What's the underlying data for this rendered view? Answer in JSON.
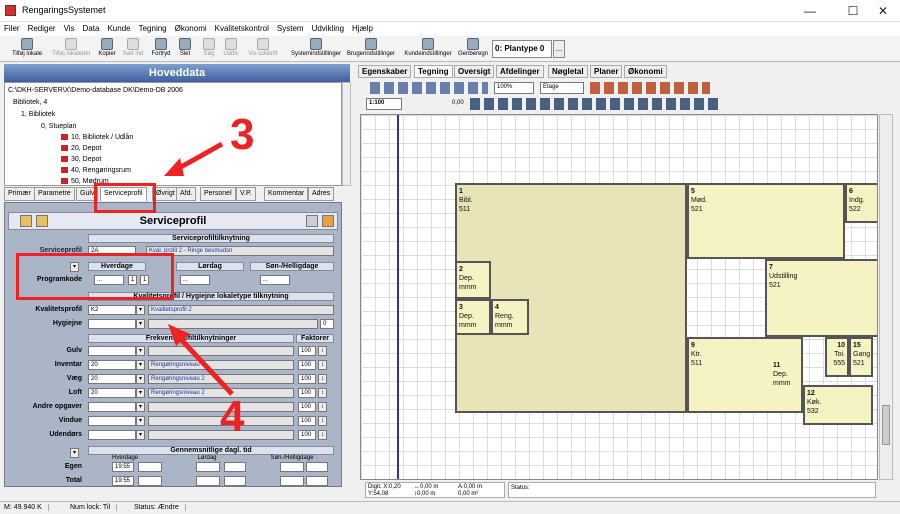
{
  "window": {
    "title": "RengaringsSystemet",
    "min": "—",
    "max": "☐",
    "close": "✕"
  },
  "menu": [
    "Filer",
    "Rediger",
    "Vis",
    "Data",
    "Kunde",
    "Tegning",
    "Økonomi",
    "Kvalitetskontrol",
    "System",
    "Udvikling",
    "Hjælp"
  ],
  "toolbar": [
    "Tilføj lokale",
    "Tilføj lokaledel",
    "Kopier",
    "Sæt ind",
    "Fortryd",
    "Slet",
    "Søg",
    "Uddiv",
    "Vis udskrift",
    "Systemindstillinger",
    "Brugerindstillinger",
    "Kundeindstillinger",
    "Genberegn"
  ],
  "plantype": "0: Plantype 0",
  "plantype_btn": "...",
  "left": {
    "header": "Hoveddata",
    "tree": [
      "C:\\DKH-SERVER\\X\\Demo-database DK\\Demo-DB 2006",
      "Bibliotek, 4",
      "1, Bibliotek",
      "0, Stueplan",
      "10, Bibliotek / Udlån",
      "20, Depot",
      "30, Depot",
      "40, Rengøringsrum",
      "50, Mødrum"
    ],
    "tabs": [
      "Primær",
      "Parametre",
      "Gulv",
      "Serviceprofil",
      "Øvrigt",
      "Afd.",
      "Personel",
      "V.P.",
      "Kommentar",
      "Adres"
    ]
  },
  "sp": {
    "title": "Serviceprofil",
    "sec_tilknytning": "Serviceprofiltilknytning",
    "lbl_serviceprofil": "Serviceprofil",
    "serviceprofil_val": "2A",
    "serviceprofil_desc": "Kval. profil 2 - Ringe besmudsn",
    "col_hverdage": "Hverdage",
    "col_lordag": "Lørdag",
    "col_son": "Søn-/Helligdage",
    "lbl_programkode": "Programkode",
    "prog_h": "...",
    "prog_h2": "1",
    "prog_h3": "1",
    "prog_l": "...",
    "prog_s": "...",
    "sec_kval": "Kvalitetsprofil / Hygiejne lokaletype tilknytning",
    "lbl_kval": "Kvalitetsprofil",
    "kval_val": "K2",
    "kval_desc": "Kvalitetsprofil 2",
    "lbl_hyg": "Hygiejne",
    "hyg_num": "0",
    "sec_frek": "Frekvensprofiltilknytninger",
    "sec_fak": "Faktorer",
    "rows": [
      {
        "label": "Gulv",
        "val": "",
        "desc": "",
        "fak": "100"
      },
      {
        "label": "Inventar",
        "val": "20",
        "desc": "Rengøringsniveau 2",
        "fak": "100"
      },
      {
        "label": "Væg",
        "val": "20",
        "desc": "Rengøringsniveau 2",
        "fak": "100"
      },
      {
        "label": "Loft",
        "val": "20",
        "desc": "Rengøringsniveau 2",
        "fak": "100"
      },
      {
        "label": "Andre opgaver",
        "val": "",
        "desc": "",
        "fak": "100"
      },
      {
        "label": "Vindue",
        "val": "",
        "desc": "",
        "fak": "100"
      },
      {
        "label": "Udendørs",
        "val": "",
        "desc": "",
        "fak": "100"
      }
    ],
    "sec_gen": "Gennemsnitlige dagl. tid",
    "g_h": "Hverdage",
    "g_l": "Lørdag",
    "g_s": "Søn-/Helligdage",
    "lbl_egen": "Egen",
    "egen_h": "19:55",
    "lbl_total": "Total",
    "total_h": "19:55"
  },
  "right": {
    "tabs": [
      "Egenskaber",
      "Tegning",
      "Oversigt",
      "Afdelinger",
      "Nøgletal",
      "Planer",
      "Økonomi"
    ],
    "zoom": "100%",
    "layer": "Etage",
    "scale": "1:100",
    "num": "0,00"
  },
  "rooms": [
    {
      "no": "1",
      "name": "Bibl.",
      "code": "511"
    },
    {
      "no": "5",
      "name": "Mød.",
      "code": "521"
    },
    {
      "no": "6",
      "name": "Indg.",
      "code": "522"
    },
    {
      "no": "2",
      "name": "Dep.",
      "code": "mmm"
    },
    {
      "no": "3",
      "name": "Dep.",
      "code": "mmm"
    },
    {
      "no": "4",
      "name": "Reng.",
      "code": "mmm"
    },
    {
      "no": "7",
      "name": "Udstilling",
      "code": "521"
    },
    {
      "no": "9",
      "name": "Ktr.",
      "code": "511"
    },
    {
      "no": "10",
      "name": "Toi.",
      "code": "555"
    },
    {
      "no": "15",
      "name": "Gang",
      "code": "521"
    },
    {
      "no": "11",
      "name": "Dep.",
      "code": "mmm"
    },
    {
      "no": "12",
      "name": "Køk.",
      "code": "532"
    }
  ],
  "coords": {
    "dx": "Digit. X:0,20",
    "dy": "Y:54,08",
    "v1": "↔0,00 m",
    "v2": "↕0,00 m",
    "v3": "A:0,00 m",
    "v4": "0,00 m²",
    "status_lbl": "Status:"
  },
  "annotations": {
    "n3": "3",
    "n4": "4"
  },
  "statusbar": {
    "mem": "M: 49.940 K",
    "num": "Num lock: Til",
    "status": "Status: Ændre"
  }
}
